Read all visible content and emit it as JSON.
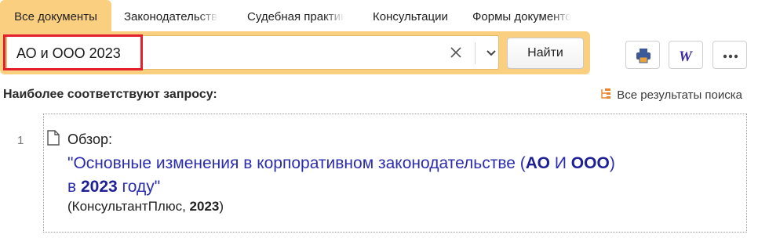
{
  "tabs": [
    {
      "label": "Все документы",
      "active": true
    },
    {
      "label": "Законодательство",
      "active": false
    },
    {
      "label": "Судебная практика",
      "active": false
    },
    {
      "label": "Консультации",
      "active": false
    },
    {
      "label": "Формы документов",
      "active": false
    }
  ],
  "search": {
    "query": "АО и ООО 2023",
    "find_label": "Найти"
  },
  "toolbar": [
    "print-icon",
    "word-export-icon",
    "more-icon"
  ],
  "results_header": {
    "title": "Наиболее соответствуют запросу:",
    "all_results": "Все результаты поиска"
  },
  "result": {
    "number": "1",
    "type": "Обзор:",
    "title": {
      "t1": "\"Основные изменения в корпоративном законодательстве (",
      "k1": "АО",
      "t2": " И ",
      "k2": "ООО",
      "t3": ")",
      "t4": "в ",
      "k3": "2023",
      "t5": " году\""
    },
    "source": {
      "s1": "(КонсультантПлюс, ",
      "k": "2023",
      "s2": ")"
    }
  },
  "colors": {
    "accent": "#fbcf80",
    "link": "#2b2dae",
    "highlight_box": "#e3212c"
  }
}
